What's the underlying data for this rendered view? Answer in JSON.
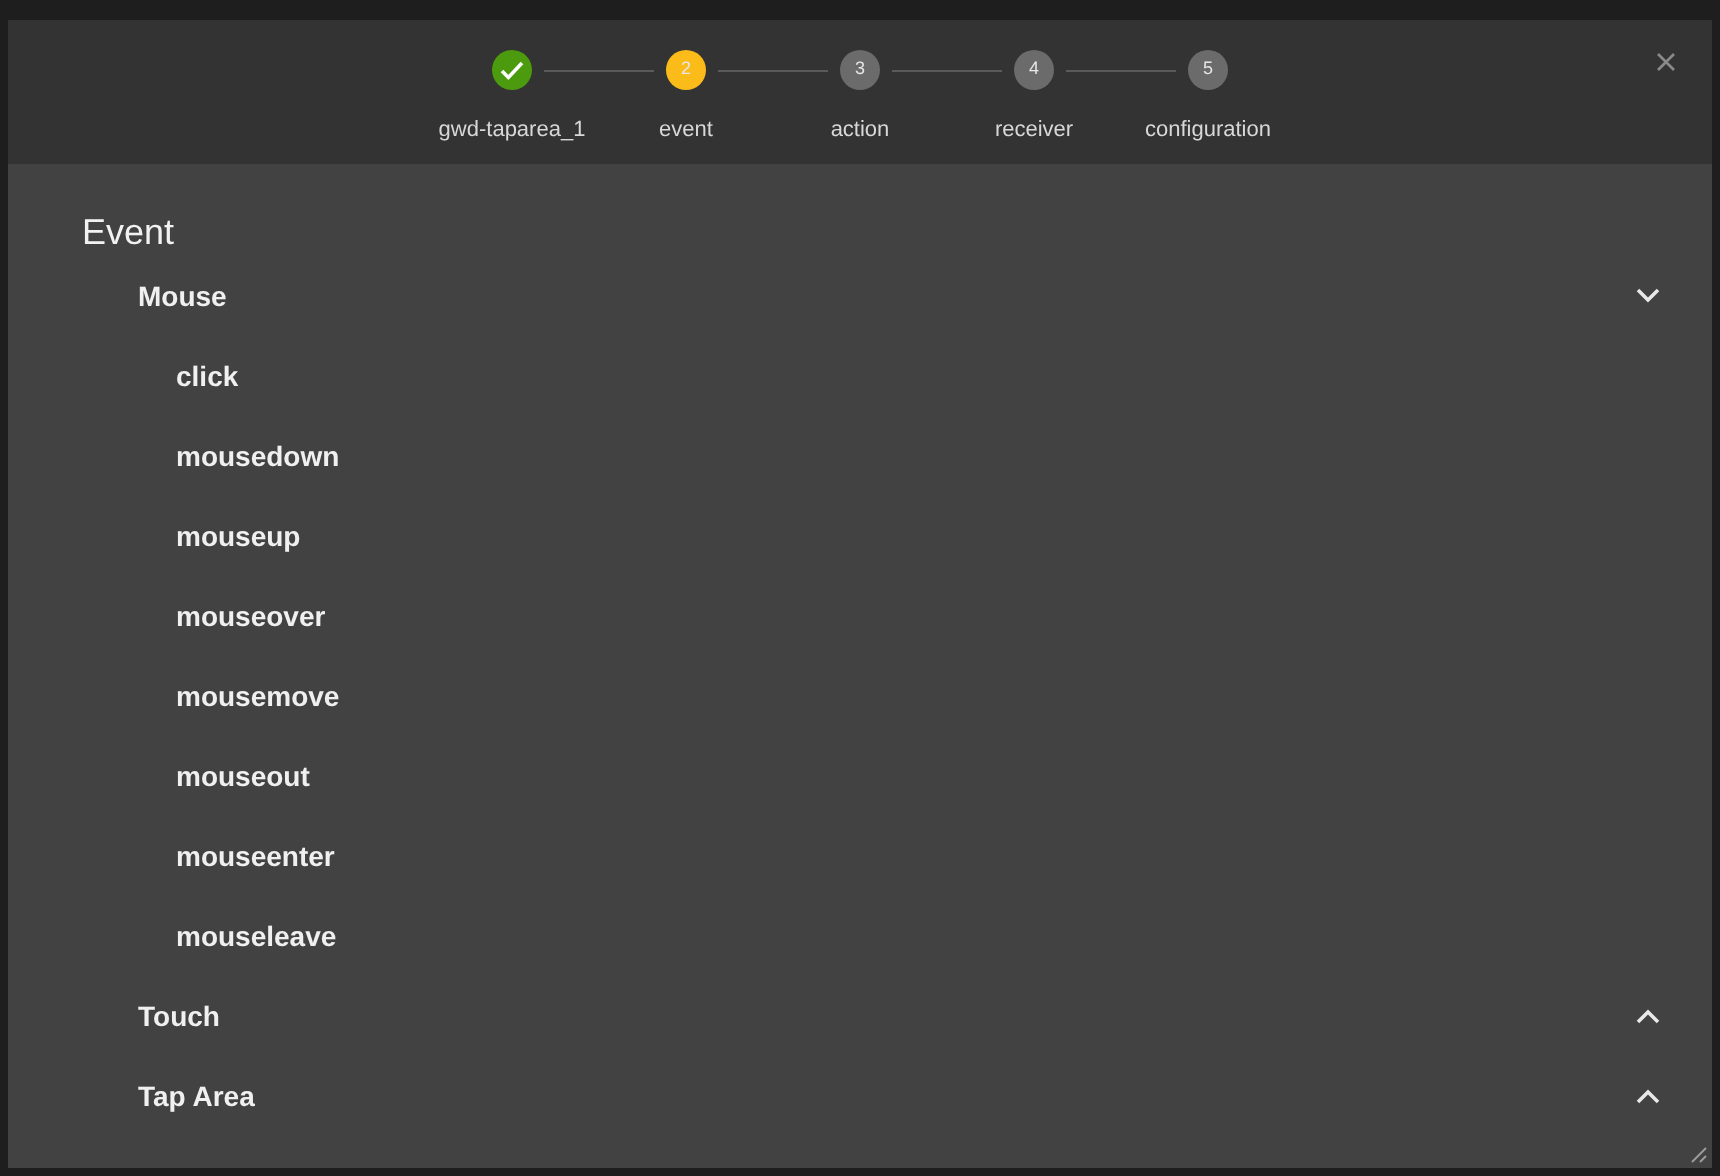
{
  "steps": [
    {
      "label": "gwd-taparea_1",
      "kind": "done"
    },
    {
      "number": "2",
      "label": "event",
      "kind": "current"
    },
    {
      "number": "3",
      "label": "action",
      "kind": "pending"
    },
    {
      "number": "4",
      "label": "receiver",
      "kind": "pending"
    },
    {
      "number": "5",
      "label": "configuration",
      "kind": "pending"
    }
  ],
  "heading": "Event",
  "categories": [
    {
      "label": "Mouse",
      "expanded": true,
      "children": [
        {
          "label": "click"
        },
        {
          "label": "mousedown"
        },
        {
          "label": "mouseup"
        },
        {
          "label": "mouseover"
        },
        {
          "label": "mousemove"
        },
        {
          "label": "mouseout"
        },
        {
          "label": "mouseenter"
        },
        {
          "label": "mouseleave"
        }
      ]
    },
    {
      "label": "Touch",
      "expanded": false
    },
    {
      "label": "Tap Area",
      "expanded": false
    }
  ]
}
